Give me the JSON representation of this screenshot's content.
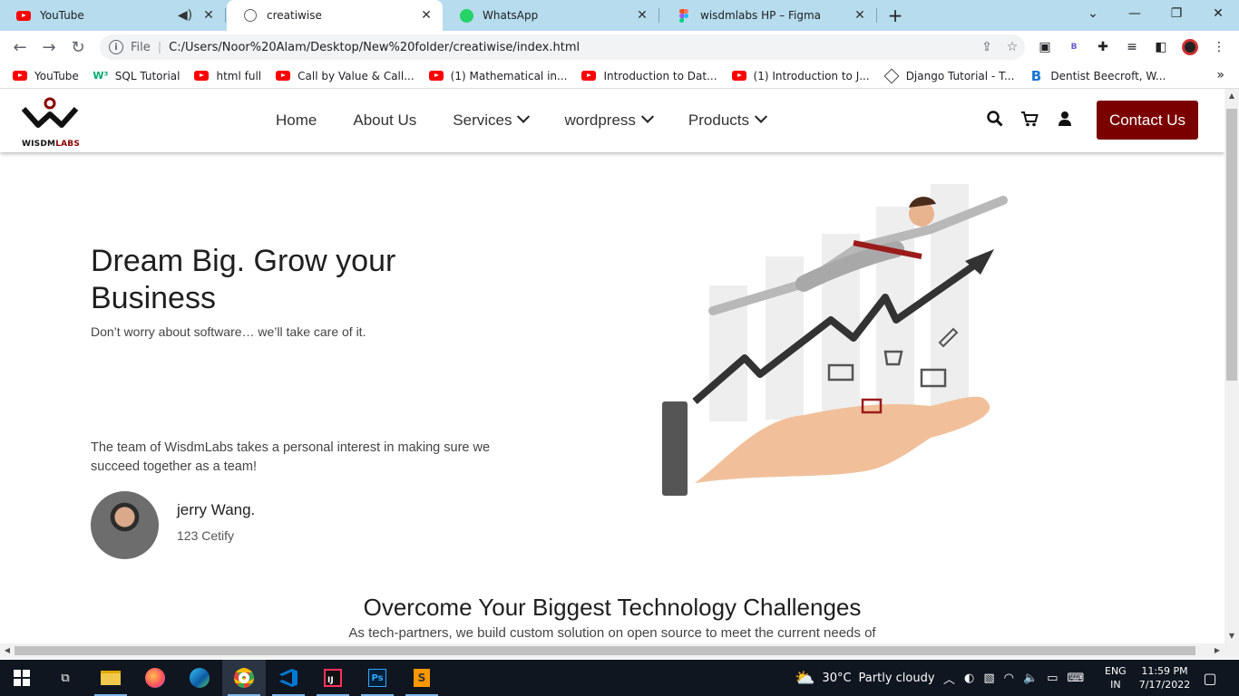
{
  "tabs": [
    {
      "title": "YouTube",
      "icon": "youtube-icon",
      "muted": true
    },
    {
      "title": "creatiwise",
      "icon": "globe-icon",
      "active": true
    },
    {
      "title": "WhatsApp",
      "icon": "whatsapp-icon"
    },
    {
      "title": "wisdmlabs HP – Figma",
      "icon": "figma-icon"
    }
  ],
  "toolbar": {
    "scheme": "File",
    "url": "C:/Users/Noor%20Alam/Desktop/New%20folder/creatiwise/index.html",
    "profile_letter": "B"
  },
  "bookmarks": [
    {
      "label": "YouTube",
      "icon": "youtube-icon"
    },
    {
      "label": "SQL Tutorial",
      "icon": "w3schools-icon"
    },
    {
      "label": "html full",
      "icon": "youtube-icon"
    },
    {
      "label": "Call by Value & Call...",
      "icon": "youtube-icon"
    },
    {
      "label": "(1) Mathematical in...",
      "icon": "youtube-icon"
    },
    {
      "label": "Introduction to Dat...",
      "icon": "youtube-icon"
    },
    {
      "label": "(1) Introduction to J...",
      "icon": "youtube-icon"
    },
    {
      "label": "Django Tutorial - T...",
      "icon": "django-icon"
    },
    {
      "label": "Dentist Beecroft, W...",
      "icon": "b-icon"
    }
  ],
  "site": {
    "logo": {
      "main": "WISDM",
      "accent": "LABS"
    },
    "nav": [
      {
        "label": "Home",
        "dropdown": false
      },
      {
        "label": "About Us",
        "dropdown": false
      },
      {
        "label": "Services",
        "dropdown": true
      },
      {
        "label": "wordpress",
        "dropdown": true
      },
      {
        "label": "Products",
        "dropdown": true
      }
    ],
    "contact_label": "Contact Us",
    "brand_color": "#7a0000"
  },
  "hero": {
    "title": "Dream Big. Grow your Business",
    "subtitle": "Don’t worry about software… we’ll take care of it.",
    "team_text": "The team of WisdmLabs takes a personal interest in making sure we succeed together as a team!",
    "person_name": "jerry Wang.",
    "person_role": "123 Cetify"
  },
  "section": {
    "title": "Overcome Your Biggest Technology Challenges",
    "subtitle": "As tech-partners, we build custom solution on open source to meet the current needs of"
  },
  "taskbar": {
    "weather_temp": "30°C",
    "weather_desc": "Partly cloudy",
    "lang_top": "ENG",
    "lang_bottom": "IN",
    "time": "11:59 PM",
    "date": "7/17/2022"
  }
}
